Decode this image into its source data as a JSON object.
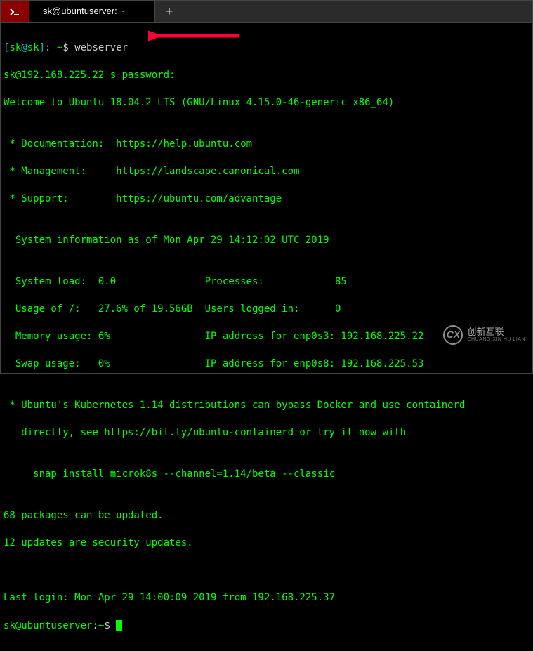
{
  "tabbar": {
    "active_tab_title": "sk@ubuntuserver: ~",
    "new_tab_label": "+"
  },
  "arrow": {
    "color": "#ff0033"
  },
  "prompt1": {
    "lb": "[",
    "user": "sk",
    "at": "@",
    "host": "sk",
    "rb": "]",
    "sep": ": ",
    "path": "~",
    "dollar": "$ ",
    "command": "webserver"
  },
  "lines": {
    "pw": "sk@192.168.225.22's password:",
    "welcome": "Welcome to Ubuntu 18.04.2 LTS (GNU/Linux 4.15.0-46-generic x86_64)",
    "blank": "",
    "doc": " * Documentation:  https://help.ubuntu.com",
    "mgmt": " * Management:     https://landscape.canonical.com",
    "support": " * Support:        https://ubuntu.com/advantage",
    "sysinfo_hdr": "  System information as of Mon Apr 29 14:12:02 UTC 2019",
    "row1": "  System load:  0.0               Processes:            85",
    "row2": "  Usage of /:   27.6% of 19.56GB  Users logged in:      0",
    "row3": "  Memory usage: 6%                IP address for enp0s3: 192.168.225.22",
    "row4": "  Swap usage:   0%                IP address for enp0s8: 192.168.225.53",
    "k8s1": " * Ubuntu's Kubernetes 1.14 distributions can bypass Docker and use containerd",
    "k8s2": "   directly, see https://bit.ly/ubuntu-containerd or try it now with",
    "snap": "     snap install microk8s --channel=1.14/beta --classic",
    "upd1": "68 packages can be updated.",
    "upd2": "12 updates are security updates.",
    "last": "Last login: Mon Apr 29 14:00:09 2019 from 192.168.225.37"
  },
  "prompt2": {
    "userhost": "sk@ubuntuserver",
    "sep": ":",
    "path": "~",
    "dollar": "$ "
  },
  "watermark": {
    "line1": "创新互联",
    "line2": "CHUANG XIN HU LIAN"
  }
}
